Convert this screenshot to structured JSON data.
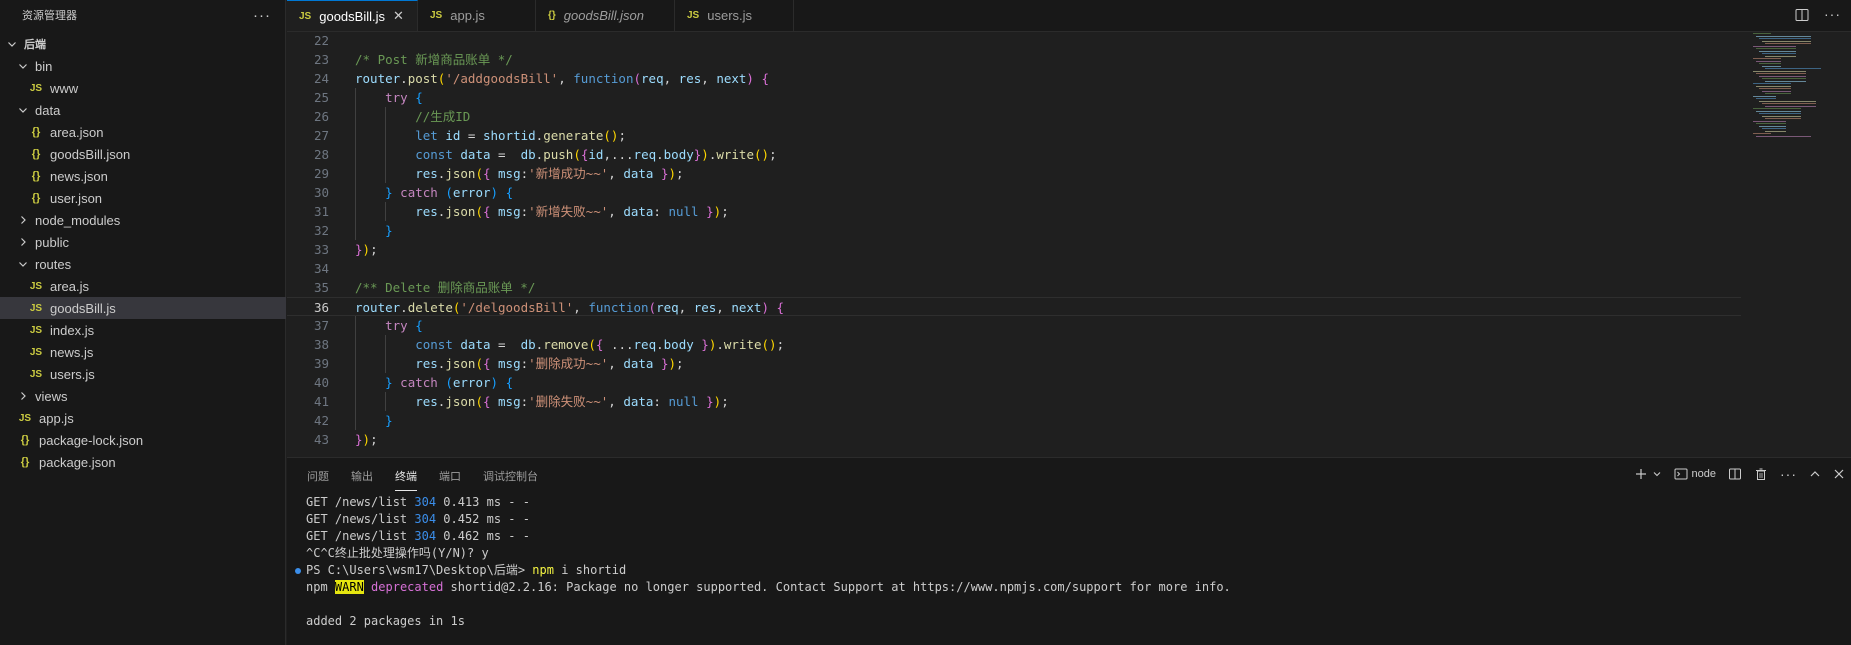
{
  "explorer": {
    "title": "资源管理器",
    "items": [
      {
        "label": "后端",
        "type": "root",
        "indent": 0,
        "open": true,
        "bold": true
      },
      {
        "label": "bin",
        "type": "folder",
        "indent": 1,
        "open": true
      },
      {
        "label": "www",
        "type": "js",
        "indent": 2
      },
      {
        "label": "data",
        "type": "folder",
        "indent": 1,
        "open": true
      },
      {
        "label": "area.json",
        "type": "json",
        "indent": 2
      },
      {
        "label": "goodsBill.json",
        "type": "json",
        "indent": 2
      },
      {
        "label": "news.json",
        "type": "json",
        "indent": 2
      },
      {
        "label": "user.json",
        "type": "json",
        "indent": 2
      },
      {
        "label": "node_modules",
        "type": "folder",
        "indent": 1,
        "open": false
      },
      {
        "label": "public",
        "type": "folder",
        "indent": 1,
        "open": false
      },
      {
        "label": "routes",
        "type": "folder",
        "indent": 1,
        "open": true
      },
      {
        "label": "area.js",
        "type": "js",
        "indent": 2
      },
      {
        "label": "goodsBill.js",
        "type": "js",
        "indent": 2,
        "selected": true
      },
      {
        "label": "index.js",
        "type": "js",
        "indent": 2
      },
      {
        "label": "news.js",
        "type": "js",
        "indent": 2
      },
      {
        "label": "users.js",
        "type": "js",
        "indent": 2
      },
      {
        "label": "views",
        "type": "folder",
        "indent": 1,
        "open": false
      },
      {
        "label": "app.js",
        "type": "js",
        "indent": 1
      },
      {
        "label": "package-lock.json",
        "type": "json",
        "indent": 1
      },
      {
        "label": "package.json",
        "type": "json",
        "indent": 1
      }
    ]
  },
  "tabs": [
    {
      "label": "goodsBill.js",
      "type": "js",
      "active": true,
      "width": 131
    },
    {
      "label": "app.js",
      "type": "js",
      "active": false,
      "width": 118
    },
    {
      "label": "goodsBill.json",
      "type": "json",
      "active": false,
      "italic": true,
      "width": 139
    },
    {
      "label": "users.js",
      "type": "js",
      "active": false,
      "width": 119
    }
  ],
  "icons": {
    "js": "JS",
    "json": "{}"
  },
  "editor": {
    "current_line": 36,
    "lines": [
      {
        "n": 22,
        "tokens": []
      },
      {
        "n": 23,
        "tokens": [
          [
            "c-comment",
            "/* Post 新增商品账单 */"
          ]
        ]
      },
      {
        "n": 24,
        "tokens": [
          [
            "c-var",
            "router"
          ],
          [
            "c-p",
            "."
          ],
          [
            "c-fn",
            "post"
          ],
          [
            "c-b1",
            "("
          ],
          [
            "c-str",
            "'/addgoodsBill'"
          ],
          [
            "c-p",
            ", "
          ],
          [
            "c-kw",
            "function"
          ],
          [
            "c-b2",
            "("
          ],
          [
            "c-var",
            "req"
          ],
          [
            "c-p",
            ", "
          ],
          [
            "c-var",
            "res"
          ],
          [
            "c-p",
            ", "
          ],
          [
            "c-var",
            "next"
          ],
          [
            "c-b2",
            ")"
          ],
          [
            "c-p",
            " "
          ],
          [
            "c-b2",
            "{"
          ]
        ]
      },
      {
        "n": 25,
        "tokens": [
          [
            "c-p",
            "    "
          ],
          [
            "c-ctl",
            "try"
          ],
          [
            "c-p",
            " "
          ],
          [
            "c-b3",
            "{"
          ]
        ]
      },
      {
        "n": 26,
        "tokens": [
          [
            "c-p",
            "        "
          ],
          [
            "c-comment",
            "//生成ID"
          ]
        ]
      },
      {
        "n": 27,
        "tokens": [
          [
            "c-p",
            "        "
          ],
          [
            "c-kw",
            "let"
          ],
          [
            "c-p",
            " "
          ],
          [
            "c-var",
            "id"
          ],
          [
            "c-p",
            " = "
          ],
          [
            "c-var",
            "shortid"
          ],
          [
            "c-p",
            "."
          ],
          [
            "c-fn",
            "generate"
          ],
          [
            "c-b1",
            "()"
          ],
          [
            "c-p",
            ";"
          ]
        ]
      },
      {
        "n": 28,
        "tokens": [
          [
            "c-p",
            "        "
          ],
          [
            "c-kw",
            "const"
          ],
          [
            "c-p",
            " "
          ],
          [
            "c-var",
            "data"
          ],
          [
            "c-p",
            " =  "
          ],
          [
            "c-var",
            "db"
          ],
          [
            "c-p",
            "."
          ],
          [
            "c-fn",
            "push"
          ],
          [
            "c-b1",
            "("
          ],
          [
            "c-b2",
            "{"
          ],
          [
            "c-var",
            "id"
          ],
          [
            "c-p",
            ",..."
          ],
          [
            "c-var",
            "req"
          ],
          [
            "c-p",
            "."
          ],
          [
            "c-var",
            "body"
          ],
          [
            "c-b2",
            "}"
          ],
          [
            "c-b1",
            ")"
          ],
          [
            "c-p",
            "."
          ],
          [
            "c-fn",
            "write"
          ],
          [
            "c-b1",
            "()"
          ],
          [
            "c-p",
            ";"
          ]
        ]
      },
      {
        "n": 29,
        "tokens": [
          [
            "c-p",
            "        "
          ],
          [
            "c-var",
            "res"
          ],
          [
            "c-p",
            "."
          ],
          [
            "c-fn",
            "json"
          ],
          [
            "c-b1",
            "("
          ],
          [
            "c-b2",
            "{"
          ],
          [
            "c-p",
            " "
          ],
          [
            "c-var",
            "msg"
          ],
          [
            "c-p",
            ":"
          ],
          [
            "c-str",
            "'新增成功~~'"
          ],
          [
            "c-p",
            ", "
          ],
          [
            "c-var",
            "data"
          ],
          [
            "c-p",
            " "
          ],
          [
            "c-b2",
            "}"
          ],
          [
            "c-b1",
            ")"
          ],
          [
            "c-p",
            ";"
          ]
        ]
      },
      {
        "n": 30,
        "tokens": [
          [
            "c-p",
            "    "
          ],
          [
            "c-b3",
            "}"
          ],
          [
            "c-p",
            " "
          ],
          [
            "c-ctl",
            "catch"
          ],
          [
            "c-p",
            " "
          ],
          [
            "c-b3",
            "("
          ],
          [
            "c-var",
            "error"
          ],
          [
            "c-b3",
            ")"
          ],
          [
            "c-p",
            " "
          ],
          [
            "c-b3",
            "{"
          ]
        ]
      },
      {
        "n": 31,
        "tokens": [
          [
            "c-p",
            "        "
          ],
          [
            "c-var",
            "res"
          ],
          [
            "c-p",
            "."
          ],
          [
            "c-fn",
            "json"
          ],
          [
            "c-b1",
            "("
          ],
          [
            "c-b2",
            "{"
          ],
          [
            "c-p",
            " "
          ],
          [
            "c-var",
            "msg"
          ],
          [
            "c-p",
            ":"
          ],
          [
            "c-str",
            "'新增失败~~'"
          ],
          [
            "c-p",
            ", "
          ],
          [
            "c-var",
            "data"
          ],
          [
            "c-p",
            ": "
          ],
          [
            "c-kw",
            "null"
          ],
          [
            "c-p",
            " "
          ],
          [
            "c-b2",
            "}"
          ],
          [
            "c-b1",
            ")"
          ],
          [
            "c-p",
            ";"
          ]
        ]
      },
      {
        "n": 32,
        "tokens": [
          [
            "c-p",
            "    "
          ],
          [
            "c-b3",
            "}"
          ]
        ]
      },
      {
        "n": 33,
        "tokens": [
          [
            "c-b2",
            "}"
          ],
          [
            "c-b1",
            ")"
          ],
          [
            "c-p",
            ";"
          ]
        ]
      },
      {
        "n": 34,
        "tokens": []
      },
      {
        "n": 35,
        "tokens": [
          [
            "c-comment",
            "/** Delete 删除商品账单 */"
          ]
        ]
      },
      {
        "n": 36,
        "tokens": [
          [
            "c-var",
            "router"
          ],
          [
            "c-p",
            "."
          ],
          [
            "c-fn",
            "delete"
          ],
          [
            "c-b1",
            "("
          ],
          [
            "c-str",
            "'/delgoodsBill'"
          ],
          [
            "c-p",
            ", "
          ],
          [
            "c-kw",
            "function"
          ],
          [
            "c-b2",
            "("
          ],
          [
            "c-var",
            "req"
          ],
          [
            "c-p",
            ", "
          ],
          [
            "c-var",
            "res"
          ],
          [
            "c-p",
            ", "
          ],
          [
            "c-var",
            "next"
          ],
          [
            "c-b2",
            ")"
          ],
          [
            "c-p",
            " "
          ],
          [
            "c-b2",
            "{"
          ]
        ]
      },
      {
        "n": 37,
        "tokens": [
          [
            "c-p",
            "    "
          ],
          [
            "c-ctl",
            "try"
          ],
          [
            "c-p",
            " "
          ],
          [
            "c-b3",
            "{"
          ]
        ]
      },
      {
        "n": 38,
        "tokens": [
          [
            "c-p",
            "        "
          ],
          [
            "c-kw",
            "const"
          ],
          [
            "c-p",
            " "
          ],
          [
            "c-var",
            "data"
          ],
          [
            "c-p",
            " =  "
          ],
          [
            "c-var",
            "db"
          ],
          [
            "c-p",
            "."
          ],
          [
            "c-fn",
            "remove"
          ],
          [
            "c-b1",
            "("
          ],
          [
            "c-b2",
            "{"
          ],
          [
            "c-p",
            " ..."
          ],
          [
            "c-var",
            "req"
          ],
          [
            "c-p",
            "."
          ],
          [
            "c-var",
            "body"
          ],
          [
            "c-p",
            " "
          ],
          [
            "c-b2",
            "}"
          ],
          [
            "c-b1",
            ")"
          ],
          [
            "c-p",
            "."
          ],
          [
            "c-fn",
            "write"
          ],
          [
            "c-b1",
            "()"
          ],
          [
            "c-p",
            ";"
          ]
        ]
      },
      {
        "n": 39,
        "tokens": [
          [
            "c-p",
            "        "
          ],
          [
            "c-var",
            "res"
          ],
          [
            "c-p",
            "."
          ],
          [
            "c-fn",
            "json"
          ],
          [
            "c-b1",
            "("
          ],
          [
            "c-b2",
            "{"
          ],
          [
            "c-p",
            " "
          ],
          [
            "c-var",
            "msg"
          ],
          [
            "c-p",
            ":"
          ],
          [
            "c-str",
            "'删除成功~~'"
          ],
          [
            "c-p",
            ", "
          ],
          [
            "c-var",
            "data"
          ],
          [
            "c-p",
            " "
          ],
          [
            "c-b2",
            "}"
          ],
          [
            "c-b1",
            ")"
          ],
          [
            "c-p",
            ";"
          ]
        ]
      },
      {
        "n": 40,
        "tokens": [
          [
            "c-p",
            "    "
          ],
          [
            "c-b3",
            "}"
          ],
          [
            "c-p",
            " "
          ],
          [
            "c-ctl",
            "catch"
          ],
          [
            "c-p",
            " "
          ],
          [
            "c-b3",
            "("
          ],
          [
            "c-var",
            "error"
          ],
          [
            "c-b3",
            ")"
          ],
          [
            "c-p",
            " "
          ],
          [
            "c-b3",
            "{"
          ]
        ]
      },
      {
        "n": 41,
        "tokens": [
          [
            "c-p",
            "        "
          ],
          [
            "c-var",
            "res"
          ],
          [
            "c-p",
            "."
          ],
          [
            "c-fn",
            "json"
          ],
          [
            "c-b1",
            "("
          ],
          [
            "c-b2",
            "{"
          ],
          [
            "c-p",
            " "
          ],
          [
            "c-var",
            "msg"
          ],
          [
            "c-p",
            ":"
          ],
          [
            "c-str",
            "'删除失败~~'"
          ],
          [
            "c-p",
            ", "
          ],
          [
            "c-var",
            "data"
          ],
          [
            "c-p",
            ": "
          ],
          [
            "c-kw",
            "null"
          ],
          [
            "c-p",
            " "
          ],
          [
            "c-b2",
            "}"
          ],
          [
            "c-b1",
            ")"
          ],
          [
            "c-p",
            ";"
          ]
        ]
      },
      {
        "n": 42,
        "tokens": [
          [
            "c-p",
            "    "
          ],
          [
            "c-b3",
            "}"
          ]
        ]
      },
      {
        "n": 43,
        "tokens": [
          [
            "c-b2",
            "}"
          ],
          [
            "c-b1",
            ")"
          ],
          [
            "c-p",
            ";"
          ]
        ]
      }
    ]
  },
  "panel": {
    "tabs": [
      {
        "label": "问题",
        "active": false
      },
      {
        "label": "输出",
        "active": false
      },
      {
        "label": "终端",
        "active": true
      },
      {
        "label": "端口",
        "active": false
      },
      {
        "label": "调试控制台",
        "active": false
      }
    ],
    "terminal_name": "node",
    "terminal": [
      {
        "segs": [
          [
            "",
            "GET /news/list "
          ],
          [
            "t-num",
            "304"
          ],
          [
            "",
            " 0.413 ms - -"
          ]
        ]
      },
      {
        "segs": [
          [
            "",
            "GET /news/list "
          ],
          [
            "t-num",
            "304"
          ],
          [
            "",
            " 0.452 ms - -"
          ]
        ]
      },
      {
        "segs": [
          [
            "",
            "GET /news/list "
          ],
          [
            "t-num",
            "304"
          ],
          [
            "",
            " 0.462 ms - -"
          ]
        ]
      },
      {
        "segs": [
          [
            "",
            "^C^C终止批处理操作吗(Y/N)? y"
          ]
        ]
      },
      {
        "dot": true,
        "segs": [
          [
            "",
            "PS C:\\Users\\wsm17\\Desktop\\后端> "
          ],
          [
            "t-yellow",
            "npm"
          ],
          [
            "",
            " i shortid"
          ]
        ]
      },
      {
        "segs": [
          [
            "",
            "npm "
          ],
          [
            "t-warn",
            "WARN"
          ],
          [
            "",
            " "
          ],
          [
            "t-mag",
            "deprecated"
          ],
          [
            "",
            " shortid@2.2.16: Package no longer supported. Contact Support at https://www.npmjs.com/support for more info."
          ]
        ]
      },
      {
        "segs": [
          [
            "",
            ""
          ]
        ]
      },
      {
        "segs": [
          [
            "",
            "added 2 packages in 1s"
          ]
        ]
      }
    ]
  }
}
